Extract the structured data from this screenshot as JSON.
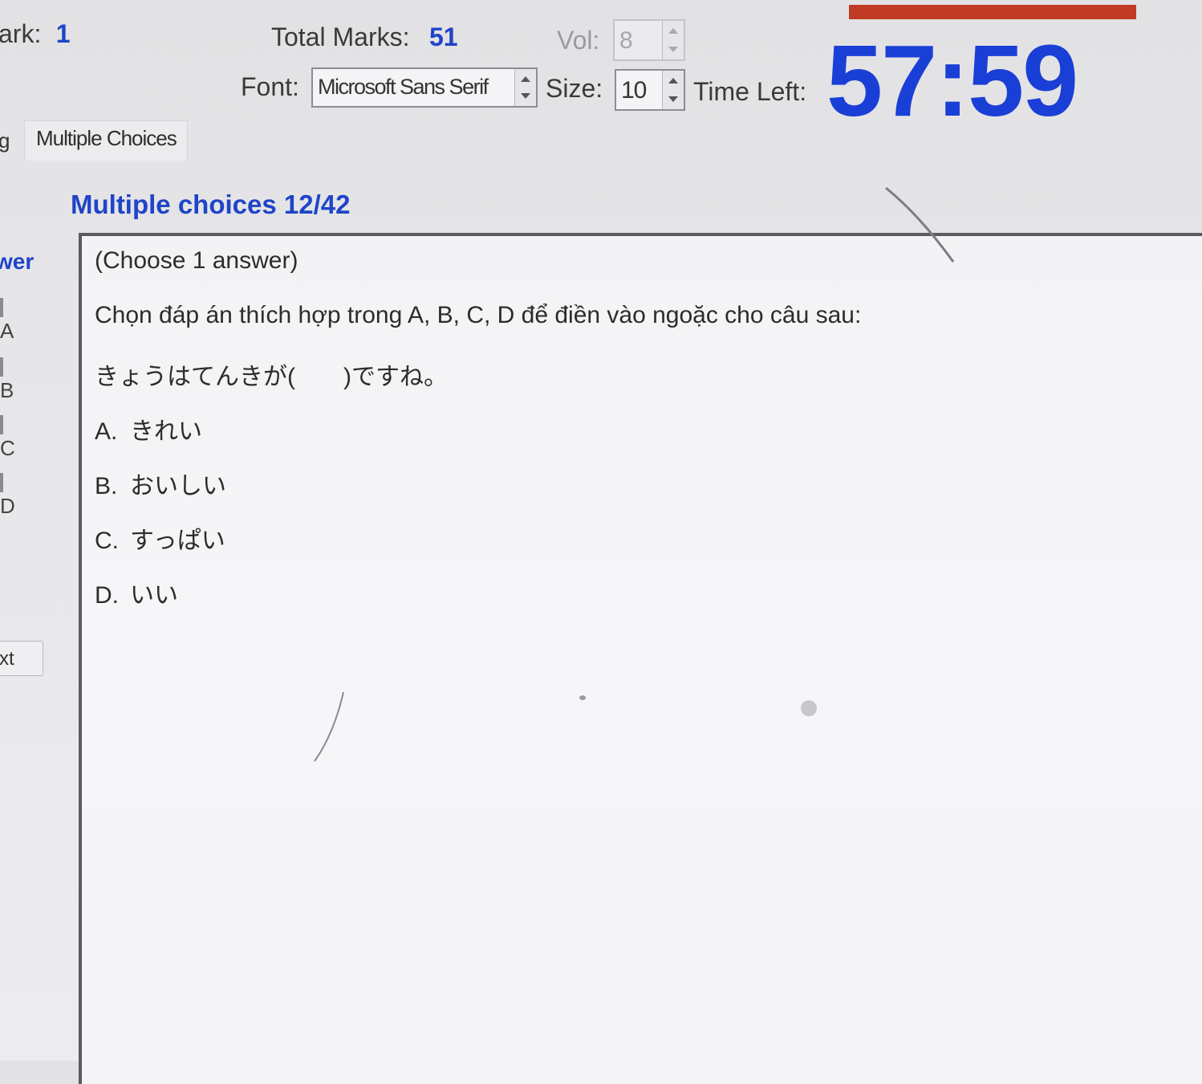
{
  "header": {
    "mark_label": "ark:",
    "mark_value": "1",
    "total_marks_label": "Total Marks:",
    "total_marks_value": "51",
    "vol_label": "Vol:",
    "vol_value": "8",
    "font_label": "Font:",
    "font_value": "Microsoft Sans Serif",
    "size_label": "Size:",
    "size_value": "10",
    "time_left_label": "Time Left:",
    "timer_value": "57:59"
  },
  "tabs": {
    "partial_label": "g",
    "active_label": "Multiple Choices"
  },
  "section": {
    "title": "Multiple choices 12/42"
  },
  "answer_column": {
    "header": "wer",
    "options": [
      "A",
      "B",
      "C",
      "D"
    ],
    "next_label": "xt"
  },
  "question": {
    "instruction": "(Choose 1 answer)",
    "prompt": "Chọn đáp án thích hợp trong A, B, C, D để điền vào ngoặc cho câu sau:",
    "sentence": "きょうはてんきが(　　)ですね。",
    "choices": [
      {
        "letter": "A.",
        "text": "きれい"
      },
      {
        "letter": "B.",
        "text": "おいしい"
      },
      {
        "letter": "C.",
        "text": "すっぱい"
      },
      {
        "letter": "D.",
        "text": "いい"
      }
    ]
  },
  "colors": {
    "accent_blue": "#1f44c8",
    "timer_blue": "#1a3fd6",
    "progress_red": "#c13a25"
  }
}
